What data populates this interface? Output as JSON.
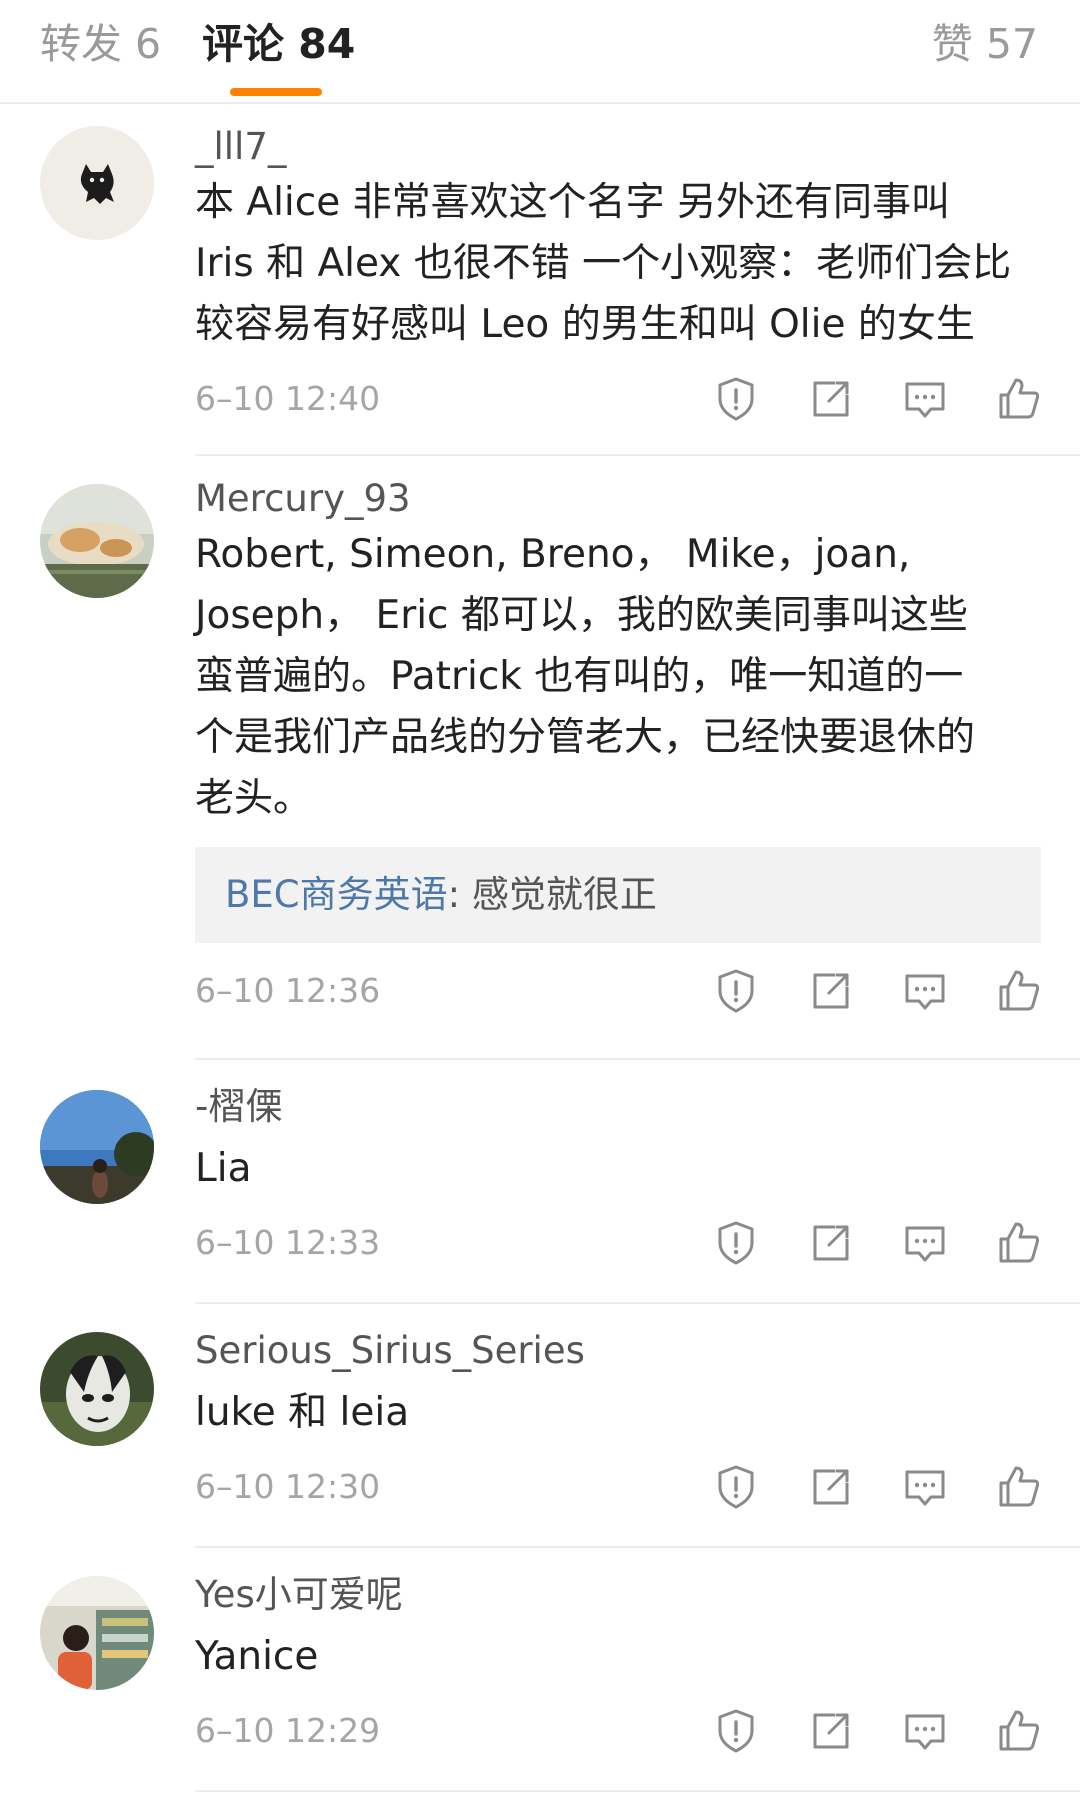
{
  "tabs": {
    "repost": "转发 6",
    "comments": "评论 84",
    "likes": "赞 57"
  },
  "colors": {
    "accent": "#ff8200",
    "link": "#4d79a8",
    "divider": "#ececec"
  },
  "icons": [
    "report-icon",
    "share-icon",
    "reply-icon",
    "like-icon"
  ],
  "comments": [
    {
      "username": "_lll7_",
      "lines": [
        "本 Alice 非常喜欢这个名字 另外还有同事叫",
        "Iris 和 Alex 也很不错 一个小观察：老师们会比",
        "较容易有好感叫 Leo 的男生和叫 Olie 的女生"
      ],
      "time": "6–10 12:40"
    },
    {
      "username": "Mercury_93",
      "lines": [
        "Robert, Simeon, Breno， Mike，joan,",
        "Joseph， Eric 都可以，我的欧美同事叫这些",
        "蛮普遍的。Patrick 也有叫的，唯一知道的一",
        "个是我们产品线的分管老大，已经快要退休的",
        "老头。"
      ],
      "reply": {
        "author": "BEC商务英语",
        "text": ": 感觉就很正"
      },
      "time": "6–10 12:36"
    },
    {
      "username": "-槢傈",
      "lines": [
        "Lia"
      ],
      "time": "6–10 12:33"
    },
    {
      "username": "Serious_Sirius_Series",
      "lines": [
        "luke 和 leia"
      ],
      "time": "6–10 12:30"
    },
    {
      "username": "Yes小可爱呢",
      "lines": [
        "Yanice"
      ],
      "time": "6–10 12:29"
    }
  ]
}
